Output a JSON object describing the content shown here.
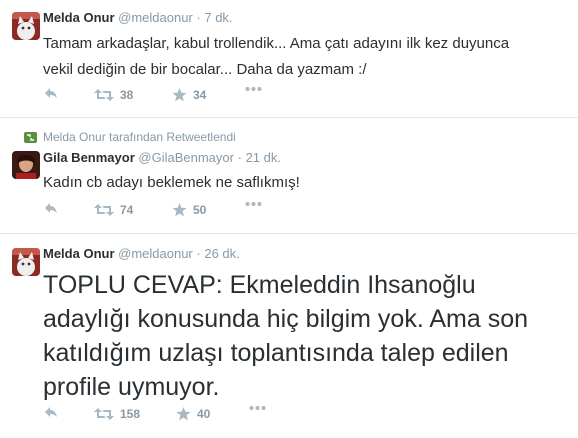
{
  "colors": {
    "text": "#292f33",
    "muted": "#8899a6",
    "divider": "#e1e8ed",
    "retweet_context_icon": "#5c913b"
  },
  "tweets": [
    {
      "fullname": "Melda Onur",
      "username": "@meldaonur",
      "separator": "·",
      "time": "7 dk.",
      "text": "Tamam arkadaşlar, kabul trollendik... Ama çatı adayını ilk kez duyunca\nvekil dediğin de bir bocalar... Daha da yazmam :/",
      "retweets": "38",
      "favorites": "34",
      "avatar_icon": "cat-avatar-icon"
    },
    {
      "retweet_context": "Melda Onur tarafından Retweetlendi",
      "fullname": "Gila Benmayor",
      "username": "@GilaBenmayor",
      "separator": "·",
      "time": "21 dk.",
      "text": "Kadın cb adayı beklemek ne saflıkmış!",
      "retweets": "74",
      "favorites": "50",
      "avatar_icon": "portrait-avatar-icon"
    },
    {
      "fullname": "Melda Onur",
      "username": "@meldaonur",
      "separator": "·",
      "time": "26 dk.",
      "text": "TOPLU CEVAP: Ekmeleddin Ihsanoğlu\nadaylığı konusunda hiç bilgim yok. Ama son\nkatıldığım uzlaşı toplantısında talep edilen\nprofile uymuyor.",
      "retweets": "158",
      "favorites": "40",
      "avatar_icon": "cat-avatar-icon"
    }
  ],
  "action_icons": [
    "reply-icon",
    "retweet-icon",
    "favorite-icon",
    "more-icon"
  ]
}
